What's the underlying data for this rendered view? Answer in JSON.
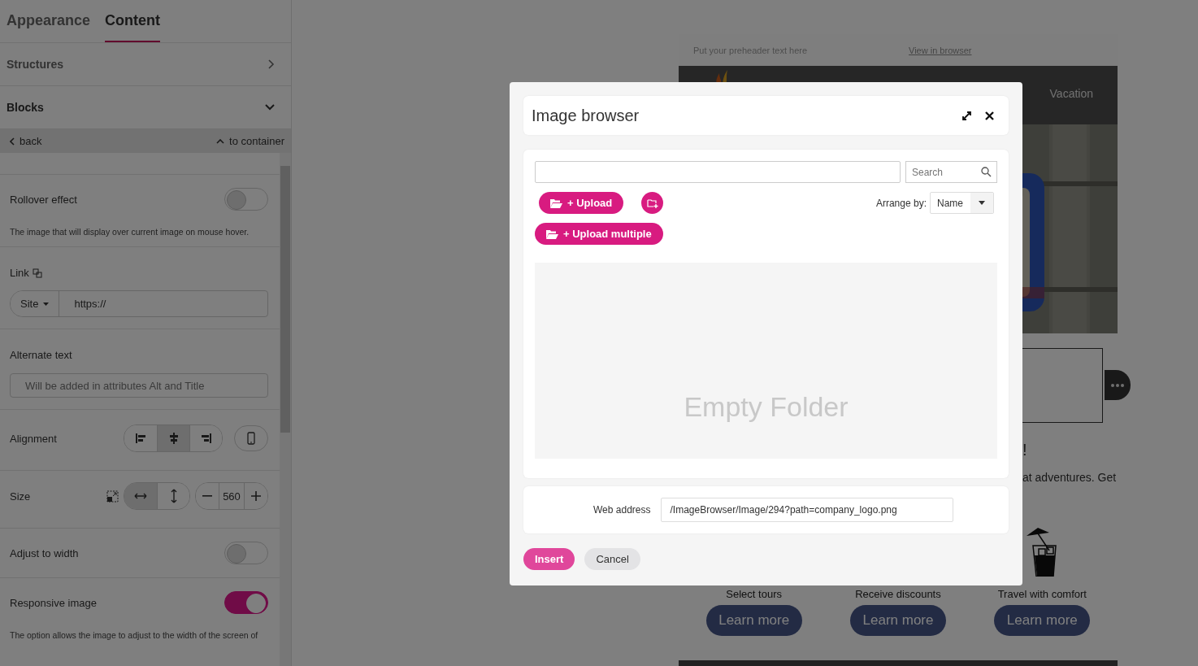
{
  "sidebar": {
    "tabs": [
      {
        "label": "Appearance",
        "selected": false
      },
      {
        "label": "Content",
        "selected": true
      }
    ],
    "sections": [
      {
        "label": "Structures",
        "expanded": false
      },
      {
        "label": "Blocks",
        "expanded": true
      }
    ],
    "nav": {
      "back": "back",
      "up": "to container"
    },
    "settings": [
      {
        "kind": "toggle",
        "label": "Rollover effect",
        "on": false,
        "note": "The image that will display over current image on mouse hover."
      },
      {
        "kind": "link",
        "label": "Link",
        "scheme": "Site",
        "value": "https://"
      },
      {
        "kind": "text",
        "label": "Alternate text",
        "placeholder": "Will be added in attributes Alt and Title"
      },
      {
        "kind": "align",
        "label": "Alignment",
        "options": [
          {
            "kind": "left",
            "selected": false
          },
          {
            "kind": "center",
            "selected": true
          },
          {
            "kind": "right",
            "selected": false
          }
        ]
      },
      {
        "kind": "size",
        "label": "Size",
        "modes": [
          {
            "kind": "width",
            "selected": true
          },
          {
            "kind": "height",
            "selected": false
          }
        ],
        "value": "560"
      },
      {
        "kind": "toggle",
        "label": "Adjust to width",
        "on": false
      },
      {
        "kind": "toggle",
        "label": "Responsive image",
        "on": true,
        "note": "The option allows the image to adjust to the width of the screen of"
      }
    ]
  },
  "email": {
    "preheader": "Put your preheader text here",
    "view_link": "View in browser",
    "menu": [
      "Vacation"
    ],
    "heading_tail": "!",
    "text_tail": "at adventures. Get",
    "features": [
      {
        "caption": "Select tours",
        "button": "Learn more"
      },
      {
        "caption": "Receive discounts",
        "button": "Learn more"
      },
      {
        "caption": "Travel with comfort",
        "button": "Learn more"
      }
    ]
  },
  "modal": {
    "title": "Image browser",
    "search": {
      "placeholder": "Search"
    },
    "upload": "+ Upload",
    "upload_multiple": "+ Upload multiple",
    "arrange_label": "Arrange by:",
    "arrange_value": "Name",
    "empty": "Empty Folder",
    "web_address_label": "Web address",
    "web_address": "/ImageBrowser/Image/294?path=company_logo.png",
    "buttons": [
      {
        "label": "Insert",
        "kind": "primary"
      },
      {
        "label": "Cancel",
        "kind": "secondary"
      }
    ]
  }
}
